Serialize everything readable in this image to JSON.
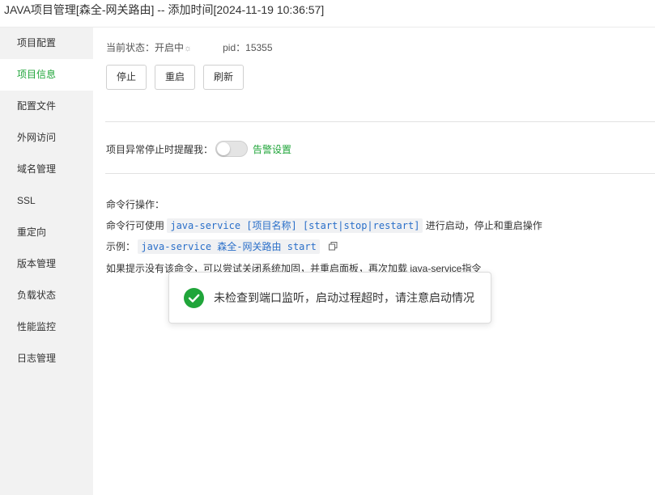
{
  "window": {
    "title": "JAVA项目管理[森全-网关路由] -- 添加时间[2024-11-19 10:36:57]"
  },
  "sidebar": {
    "items": [
      {
        "label": "项目配置"
      },
      {
        "label": "项目信息",
        "active": true
      },
      {
        "label": "配置文件"
      },
      {
        "label": "外网访问"
      },
      {
        "label": "域名管理"
      },
      {
        "label": "SSL"
      },
      {
        "label": "重定向"
      },
      {
        "label": "版本管理"
      },
      {
        "label": "负载状态"
      },
      {
        "label": "性能监控"
      },
      {
        "label": "日志管理"
      }
    ]
  },
  "status": {
    "label": "当前状态：",
    "value": "开启中",
    "spinner_icon": "loading-spinner-icon",
    "pid_label": "pid：",
    "pid_value": "15355"
  },
  "buttons": {
    "stop": "停止",
    "restart": "重启",
    "refresh": "刷新"
  },
  "alert": {
    "label": "项目异常停止时提醒我：",
    "toggle_on": false,
    "settings_link": "告警设置"
  },
  "command": {
    "heading": "命令行操作：",
    "usage_prefix": "命令行可使用",
    "usage_code": "java-service [项目名称] [start|stop|restart]",
    "usage_suffix": "进行启动，停止和重启操作",
    "example_label": "示例：",
    "example_code": "java-service 森全-网关路由 start",
    "hint": "如果提示没有该命令，可以尝试关闭系统加固，并重启面板，再次加载 java-service指令"
  },
  "toast": {
    "message": "未检查到端口监听，启动过程超时，请注意启动情况",
    "icon": "success-check-icon"
  },
  "colors": {
    "accent_green": "#20a53a",
    "code_blue": "#2a6fc9",
    "sidebar_bg": "#f2f2f2"
  }
}
